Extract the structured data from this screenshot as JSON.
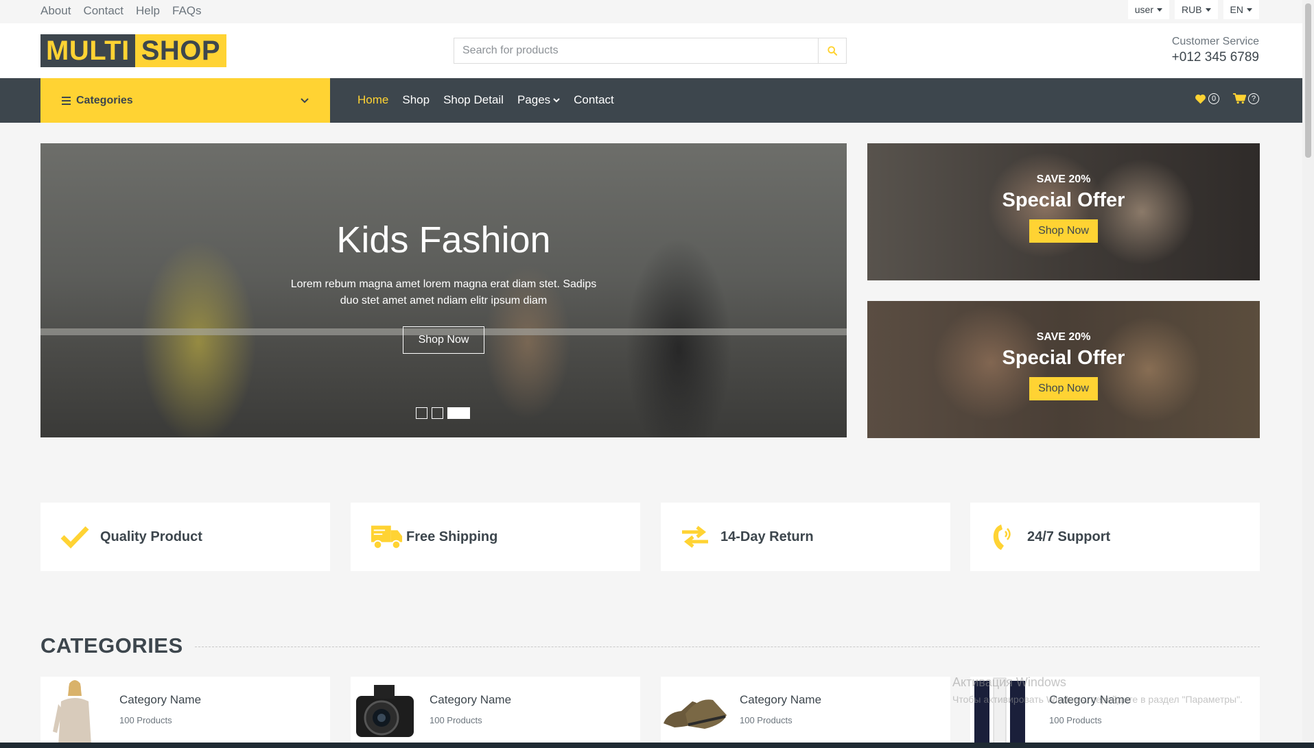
{
  "topbar": {
    "links": [
      "About",
      "Contact",
      "Help",
      "FAQs"
    ],
    "user_label": "user",
    "currency_label": "RUB",
    "lang_label": "EN"
  },
  "header": {
    "logo_part1": "MULTI",
    "logo_part2": "SHOP",
    "search_placeholder": "Search for products",
    "search_icon": "search-icon",
    "cs_label": "Customer Service",
    "cs_phone": "+012 345 6789"
  },
  "navbar": {
    "categories_label": "Categories",
    "menu": {
      "home": "Home",
      "shop": "Shop",
      "shop_detail": "Shop Detail",
      "pages": "Pages",
      "contact": "Contact"
    },
    "wishlist_count": "0",
    "cart_count": "?"
  },
  "hero": {
    "title": "Kids Fashion",
    "text": "Lorem rebum magna amet lorem magna erat diam stet. Sadips duo stet amet amet ndiam elitr ipsum diam",
    "button": "Shop Now",
    "active_slide": 3
  },
  "offers": [
    {
      "save": "SAVE 20%",
      "title": "Special Offer",
      "button": "Shop Now"
    },
    {
      "save": "SAVE 20%",
      "title": "Special Offer",
      "button": "Shop Now"
    }
  ],
  "features": [
    {
      "label": "Quality Product",
      "icon": "check-icon"
    },
    {
      "label": "Free Shipping",
      "icon": "truck-icon"
    },
    {
      "label": "14-Day Return",
      "icon": "exchange-icon"
    },
    {
      "label": "24/7 Support",
      "icon": "phone-volume-icon"
    }
  ],
  "categories": {
    "title": "CATEGORIES",
    "items": [
      {
        "name": "Category Name",
        "count": "100 Products"
      },
      {
        "name": "Category Name",
        "count": "100 Products"
      },
      {
        "name": "Category Name",
        "count": "100 Products"
      },
      {
        "name": "Category Name",
        "count": "100 Products"
      }
    ]
  },
  "watermark": {
    "line1": "Активация Windows",
    "line2": "Чтобы активировать Windows, перейдите в раздел \"Параметры\"."
  },
  "colors": {
    "accent": "#ffd333",
    "dark": "#3d464d",
    "bg": "#f5f5f5"
  }
}
